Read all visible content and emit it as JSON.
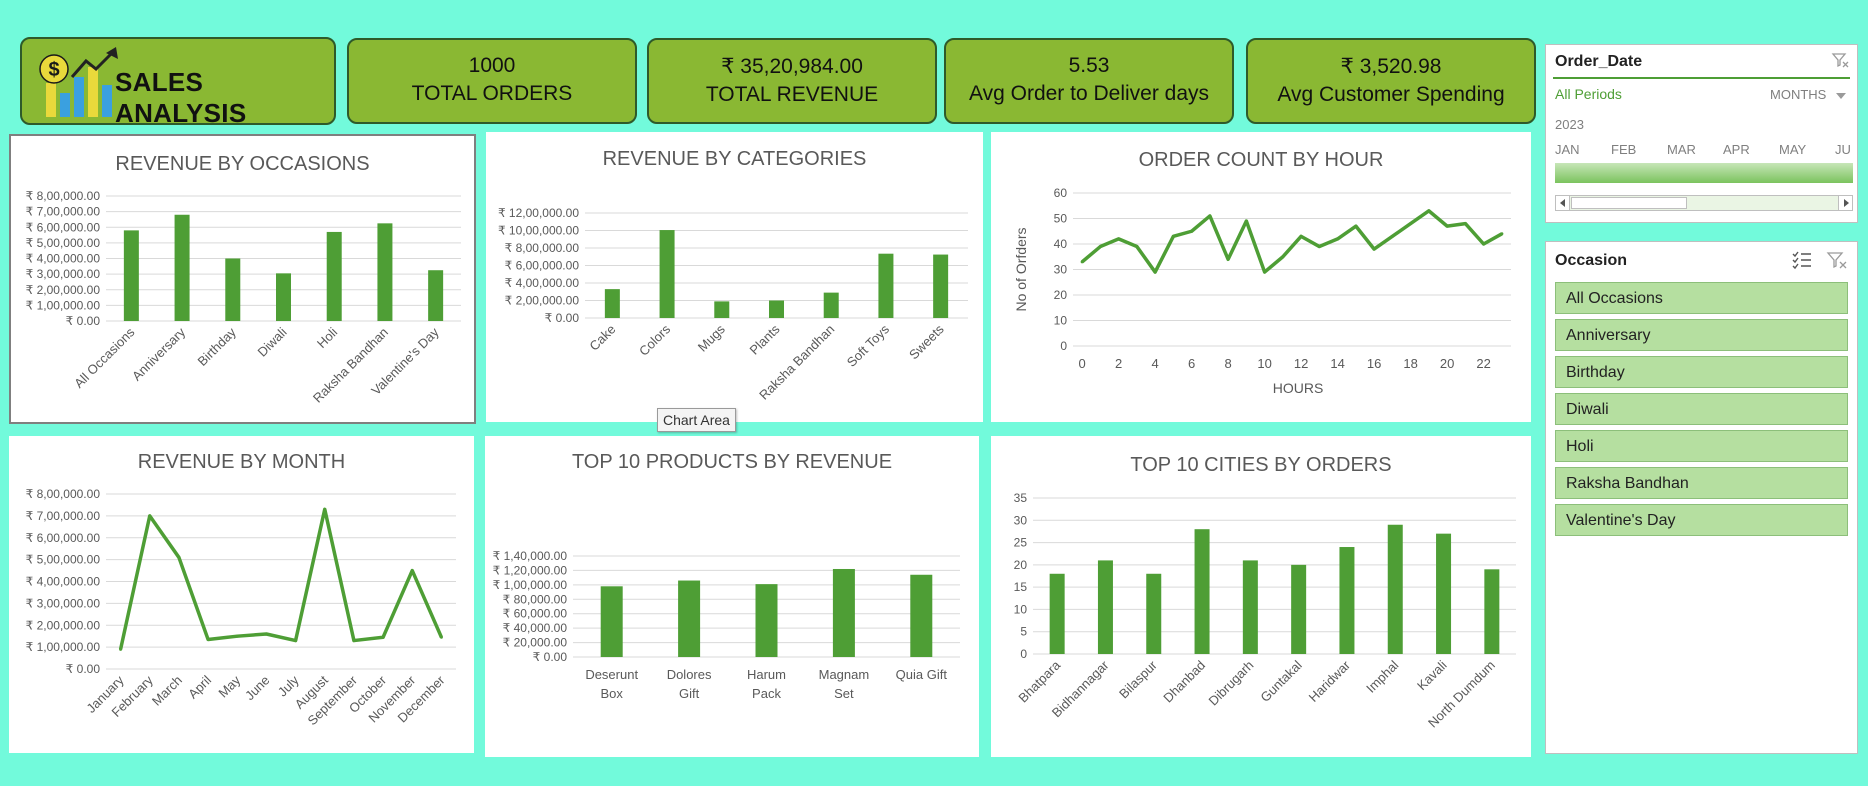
{
  "brand": {
    "title": "SALES ANALYSIS"
  },
  "kpis": [
    {
      "value": "1000",
      "label": "TOTAL ORDERS"
    },
    {
      "value": "₹ 35,20,984.00",
      "label": "TOTAL REVENUE"
    },
    {
      "value": "5.53",
      "label": "Avg Order to Deliver days"
    },
    {
      "value": "₹ 3,520.98",
      "label": "Avg Customer Spending"
    }
  ],
  "date_slicer": {
    "title": "Order_Date",
    "period": "All Periods",
    "granularity": "MONTHS",
    "year": "2023",
    "months": [
      "JAN",
      "FEB",
      "MAR",
      "APR",
      "MAY",
      "JU"
    ]
  },
  "occasion_slicer": {
    "title": "Occasion",
    "items": [
      "All Occasions",
      "Anniversary",
      "Birthday",
      "Diwali",
      "Holi",
      "Raksha Bandhan",
      "Valentine's Day"
    ]
  },
  "tooltip": "Chart Area",
  "colors": {
    "bar": "#4e9e35",
    "kpi": "#8ab833",
    "background": "#72fadb",
    "slicer_item": "#b5dfa0"
  },
  "chart_data": [
    {
      "id": "occasions",
      "type": "bar",
      "title": "REVENUE BY OCCASIONS",
      "categories": [
        "All Occasions",
        "Anniversary",
        "Birthday",
        "Diwali",
        "Holi",
        "Raksha Bandhan",
        "Valentine's Day"
      ],
      "values": [
        580000,
        680000,
        400000,
        305000,
        570000,
        625000,
        325000
      ],
      "ylim": [
        0,
        800000
      ],
      "yticks": [
        "₹ 0.00",
        "₹ 1,00,000.00",
        "₹ 2,00,000.00",
        "₹ 3,00,000.00",
        "₹ 4,00,000.00",
        "₹ 5,00,000.00",
        "₹ 6,00,000.00",
        "₹ 7,00,000.00",
        "₹ 8,00,000.00"
      ]
    },
    {
      "id": "categories",
      "type": "bar",
      "title": "REVENUE BY CATEGORIES",
      "categories": [
        "Cake",
        "Colors",
        "Mugs",
        "Plants",
        "Raksha Bandhan",
        "Soft Toys",
        "Sweets"
      ],
      "values": [
        330000,
        1005000,
        190000,
        200000,
        290000,
        735000,
        725000
      ],
      "ylim": [
        0,
        1200000
      ],
      "yticks": [
        "₹ 0.00",
        "₹ 2,00,000.00",
        "₹ 4,00,000.00",
        "₹ 6,00,000.00",
        "₹ 8,00,000.00",
        "₹ 10,00,000.00",
        "₹ 12,00,000.00"
      ]
    },
    {
      "id": "hours",
      "type": "line",
      "title": "ORDER COUNT BY HOUR",
      "xlabel": "HOURS",
      "ylabel": "No of Orfders",
      "x": [
        0,
        1,
        2,
        3,
        4,
        5,
        6,
        7,
        8,
        9,
        10,
        11,
        12,
        13,
        14,
        15,
        16,
        17,
        18,
        19,
        20,
        21,
        22,
        23
      ],
      "values": [
        33,
        39,
        42,
        39,
        29,
        43,
        45,
        51,
        34,
        49,
        29,
        35,
        43,
        39,
        42,
        47,
        38,
        43,
        48,
        53,
        47,
        48,
        40,
        44
      ],
      "ylim": [
        0,
        60
      ],
      "yticks": [
        "0",
        "10",
        "20",
        "30",
        "40",
        "50",
        "60"
      ],
      "xticks": [
        "0",
        "2",
        "4",
        "6",
        "8",
        "10",
        "12",
        "14",
        "16",
        "18",
        "20",
        "22"
      ]
    },
    {
      "id": "months",
      "type": "line",
      "title": "REVENUE BY MONTH",
      "categories": [
        "January",
        "February",
        "March",
        "April",
        "May",
        "June",
        "July",
        "August",
        "September",
        "October",
        "November",
        "December"
      ],
      "values": [
        90000,
        700000,
        510000,
        135000,
        150000,
        160000,
        130000,
        730000,
        130000,
        145000,
        450000,
        145000
      ],
      "ylim": [
        0,
        800000
      ],
      "yticks": [
        "₹ 0.00",
        "₹ 1,00,000.00",
        "₹ 2,00,000.00",
        "₹ 3,00,000.00",
        "₹ 4,00,000.00",
        "₹ 5,00,000.00",
        "₹ 6,00,000.00",
        "₹ 7,00,000.00",
        "₹ 8,00,000.00"
      ]
    },
    {
      "id": "products",
      "type": "bar",
      "title": "TOP 10 PRODUCTS BY REVENUE",
      "categories": [
        [
          "Deserunt",
          "Box"
        ],
        [
          "Dolores",
          "Gift"
        ],
        [
          "Harum",
          "Pack"
        ],
        [
          "Magnam",
          "Set"
        ],
        [
          "Quia Gift"
        ]
      ],
      "values": [
        98000,
        106000,
        101000,
        122000,
        114000
      ],
      "ylim": [
        0,
        140000
      ],
      "yticks": [
        "₹ 0.00",
        "₹ 20,000.00",
        "₹ 40,000.00",
        "₹ 60,000.00",
        "₹ 80,000.00",
        "₹ 1,00,000.00",
        "₹ 1,20,000.00",
        "₹ 1,40,000.00"
      ]
    },
    {
      "id": "cities",
      "type": "bar",
      "title": "TOP 10 CITIES BY ORDERS",
      "categories": [
        "Bhatpara",
        "Bidhannagar",
        "Bilaspur",
        "Dhanbad",
        "Dibrugarh",
        "Guntakal",
        "Haridwar",
        "Imphal",
        "Kavali",
        "North Dumdum"
      ],
      "values": [
        18,
        21,
        18,
        28,
        21,
        20,
        24,
        29,
        27,
        19
      ],
      "ylim": [
        0,
        35
      ],
      "yticks": [
        "0",
        "5",
        "10",
        "15",
        "20",
        "25",
        "30",
        "35"
      ]
    }
  ]
}
